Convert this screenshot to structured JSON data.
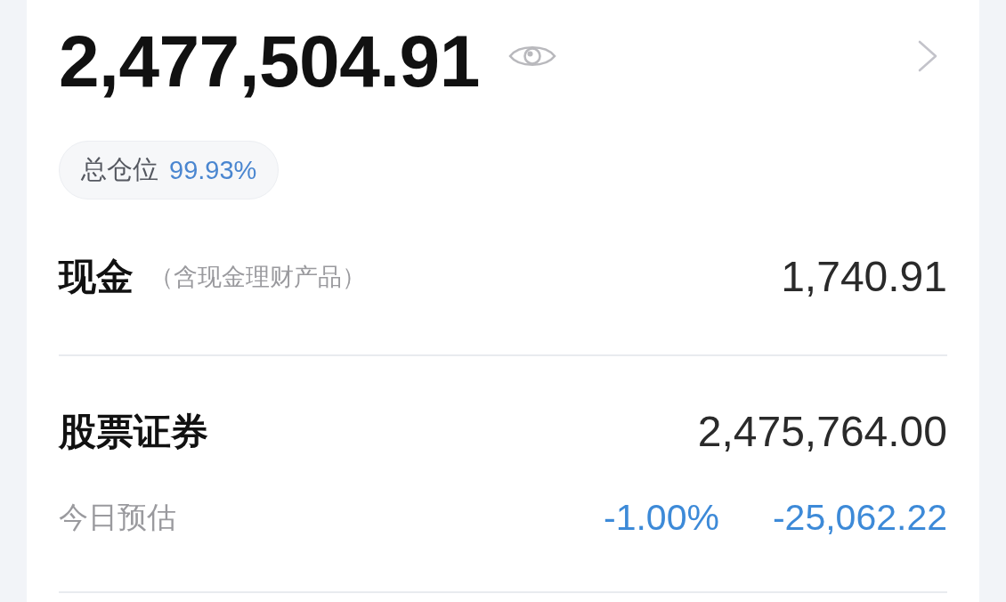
{
  "header": {
    "total_assets": "2,477,504.91",
    "position": {
      "label": "总仓位",
      "value": "99.93%"
    }
  },
  "sections": [
    {
      "kind": "cash",
      "title": "现金",
      "note": "（含现金理财产品）",
      "value": "1,740.91"
    },
    {
      "kind": "stocks",
      "title": "股票证券",
      "value": "2,475,764.00",
      "estimate": {
        "label": "今日预估",
        "percent": "-1.00%",
        "amount": "-25,062.22"
      }
    }
  ]
}
